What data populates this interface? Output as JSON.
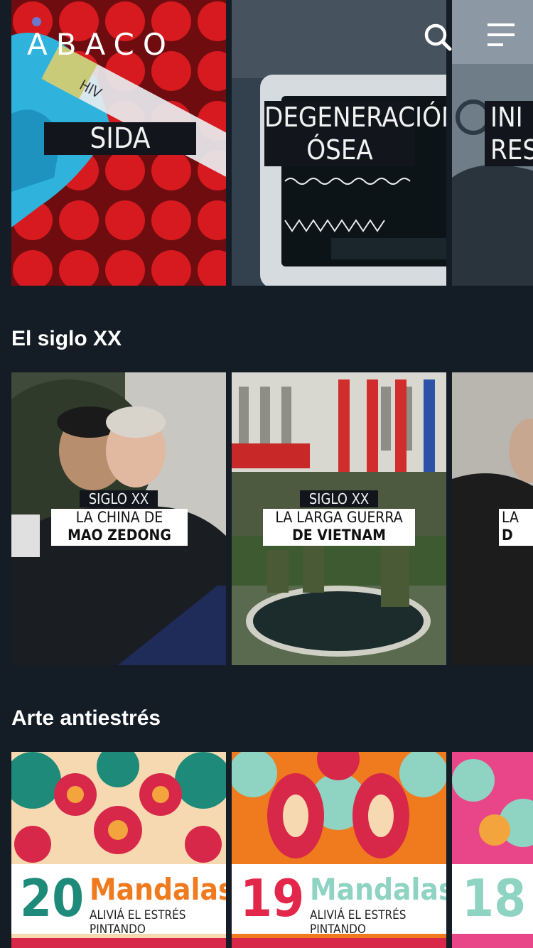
{
  "header": {
    "logo_text": "ABACO",
    "logo_accent": "#6a78d0"
  },
  "rows": {
    "health": {
      "cards": [
        {
          "title": "SIDA",
          "tube_label": "HIV"
        },
        {
          "title_line1": "DEGENERACIÓN",
          "title_line2": "ÓSEA"
        },
        {
          "title_line1": "INI",
          "title_line2": "RES"
        }
      ]
    },
    "siglo": {
      "title": "El siglo XX",
      "cards": [
        {
          "tag": "SIGLO XX",
          "line1": "LA CHINA DE",
          "line2": "MAO ZEDONG"
        },
        {
          "tag": "SIGLO XX",
          "line1": "LA LARGA GUERRA",
          "line2": "DE VIETNAM"
        },
        {
          "line1": "LA",
          "line2": "D"
        }
      ]
    },
    "arte": {
      "title": "Arte antiestrés",
      "cards": [
        {
          "number": "20",
          "word": "Mandalas",
          "sub": "ALIVIÁ EL ESTRÉS PINTANDO",
          "num_color": "#1e8a7a",
          "word_color": "#f07a1e"
        },
        {
          "number": "19",
          "word": "Mandalas",
          "sub": "ALIVIÁ EL ESTRÉS PINTANDO",
          "num_color": "#e3274a",
          "word_color": "#8fd3c2"
        },
        {
          "number": "18",
          "num_color": "#8fd3c2"
        }
      ]
    }
  }
}
